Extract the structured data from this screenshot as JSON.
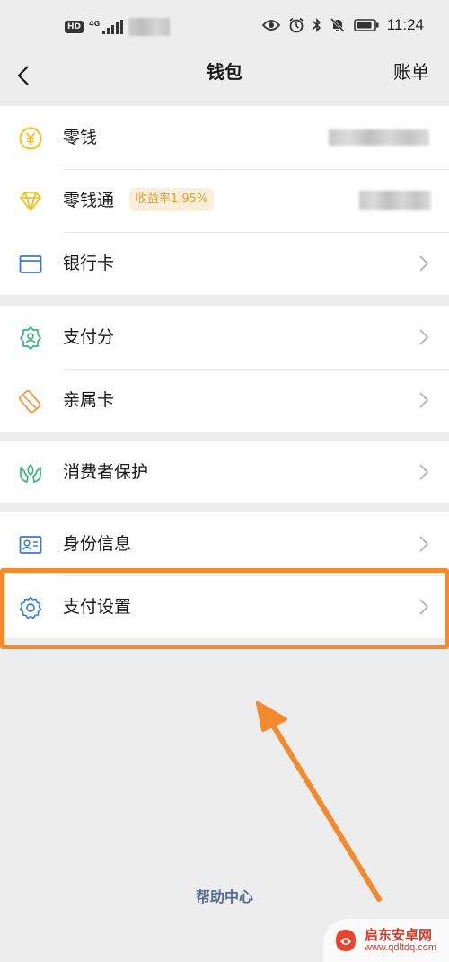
{
  "status_bar": {
    "hd": "HD",
    "network": "4G",
    "time": "11:24"
  },
  "nav": {
    "title": "钱包",
    "action": "账单"
  },
  "groups": [
    {
      "items": [
        {
          "label": "零钱",
          "icon": "yuan-coin-icon"
        },
        {
          "label": "零钱通",
          "icon": "diamond-icon",
          "badge": "收益率1.95%"
        },
        {
          "label": "银行卡",
          "icon": "bank-card-icon"
        }
      ]
    },
    {
      "items": [
        {
          "label": "支付分",
          "icon": "credit-score-icon"
        },
        {
          "label": "亲属卡",
          "icon": "family-card-icon"
        }
      ]
    },
    {
      "items": [
        {
          "label": "消费者保护",
          "icon": "protection-hands-icon"
        }
      ]
    },
    {
      "items": [
        {
          "label": "身份信息",
          "icon": "id-card-icon"
        },
        {
          "label": "支付设置",
          "icon": "gear-icon"
        }
      ]
    }
  ],
  "footer": {
    "help_link": "帮助中心"
  },
  "watermark": {
    "name": "启东安卓网",
    "url": "www.qdltdq.com"
  },
  "colors": {
    "background": "#ededed",
    "highlight": "#f5892e",
    "link": "#576b95",
    "badge_text": "#e0a030",
    "badge_bg": "#fbefdb",
    "icon_yellow": "#f0c020",
    "icon_blue": "#3a7bd5",
    "icon_green": "#3bb37a",
    "icon_orange": "#f09a3e"
  }
}
